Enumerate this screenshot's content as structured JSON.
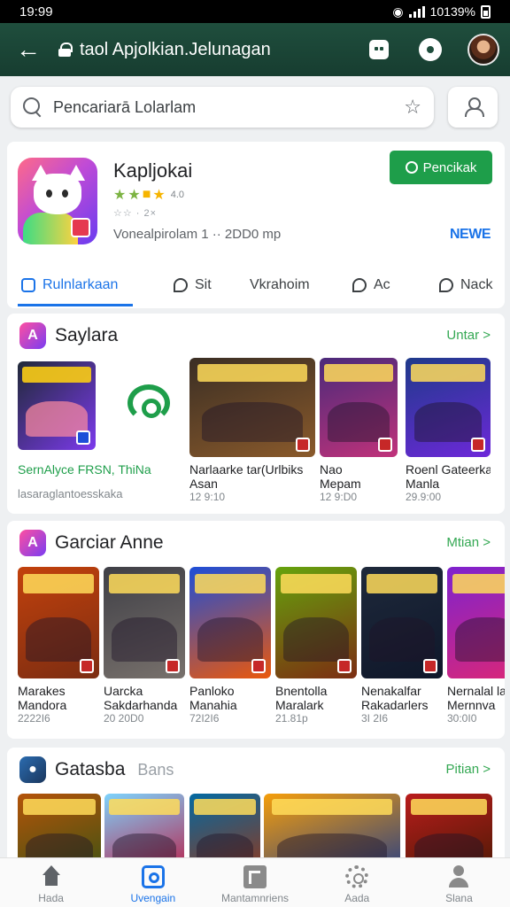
{
  "status_bar": {
    "time": "19:99",
    "right": "10139%"
  },
  "app_bar": {
    "url": "taol Apjolkian.Jelunagan"
  },
  "search": {
    "placeholder": "Pencariarā Lolarlam"
  },
  "app": {
    "title": "Kapljokai",
    "rating_text": "4.0",
    "small_meta": "☆☆ · 2×",
    "downloads": "Vonealpirolam 1 ··  2DD0 mp",
    "install_label": "Pencikak",
    "new_label": "NEWE",
    "tabs": [
      "Rulnlarkaan",
      "Sit",
      "Vkrahoim",
      "Ac",
      "Nack"
    ]
  },
  "sections": [
    {
      "title": "Saylara",
      "more": "Untar >",
      "featured_line1": "SernAlyce FRSN, ThiNa",
      "featured_line2": "lasaraglantoesskaka",
      "cards": [
        {
          "name": "Narlaarke tar(Urlbiks",
          "name2": "Asan",
          "size": "12 9:10",
          "colors": [
            "#3a2e24",
            "#8a5a2b"
          ]
        },
        {
          "name": "Nao",
          "name2": "Mepam",
          "size": "12 9:D0",
          "colors": [
            "#4a2a7a",
            "#c0327a"
          ]
        },
        {
          "name": "Roenl Gateerka",
          "name2": "Manla",
          "size": "29.9:00",
          "colors": [
            "#1e3a8a",
            "#6d28d9"
          ]
        }
      ]
    },
    {
      "title": "Garciar Anne",
      "more": "Mtian >",
      "cards": [
        {
          "name": "Marakes",
          "name2": "Mandora",
          "size": "2222I6",
          "colors": [
            "#c2410c",
            "#7c2d12"
          ]
        },
        {
          "name": "Uarcka",
          "name2": "Sakdarhanda",
          "size": "20 20D0",
          "colors": [
            "#3f3f46",
            "#78716c"
          ]
        },
        {
          "name": "Panloko",
          "name2": "Manahia",
          "size": "72I2I6",
          "colors": [
            "#1d4ed8",
            "#ea580c"
          ]
        },
        {
          "name": "Bnentolla",
          "name2": "Maralark",
          "size": "21.81p",
          "colors": [
            "#65a30d",
            "#7c2d12"
          ]
        },
        {
          "name": "Nenakalfar",
          "name2": "Rakadarlers",
          "size": "3I 2I6",
          "colors": [
            "#1e293b",
            "#0f172a"
          ]
        },
        {
          "name": "Nernalal lat Plan",
          "name2": "Mernnva",
          "size": "30:0I0",
          "colors": [
            "#7e22ce",
            "#db2777"
          ]
        }
      ]
    },
    {
      "title": "Gatasba",
      "subtitle": "Bans",
      "more": "Pitian >",
      "cards": [
        {
          "colors": [
            "#b45309",
            "#365314"
          ]
        },
        {
          "colors": [
            "#7dd3fc",
            "#be123c"
          ]
        },
        {
          "colors": [
            "#0369a1",
            "#9a3412"
          ]
        },
        {
          "colors": [
            "#f59e0b",
            "#1e3a8a"
          ]
        },
        {
          "colors": [
            "#b91c1c",
            "#451a03"
          ]
        }
      ]
    }
  ],
  "bottom_nav": [
    "Hada",
    "Uvengain",
    "Mantamnriens",
    "Aada",
    "Slana"
  ]
}
